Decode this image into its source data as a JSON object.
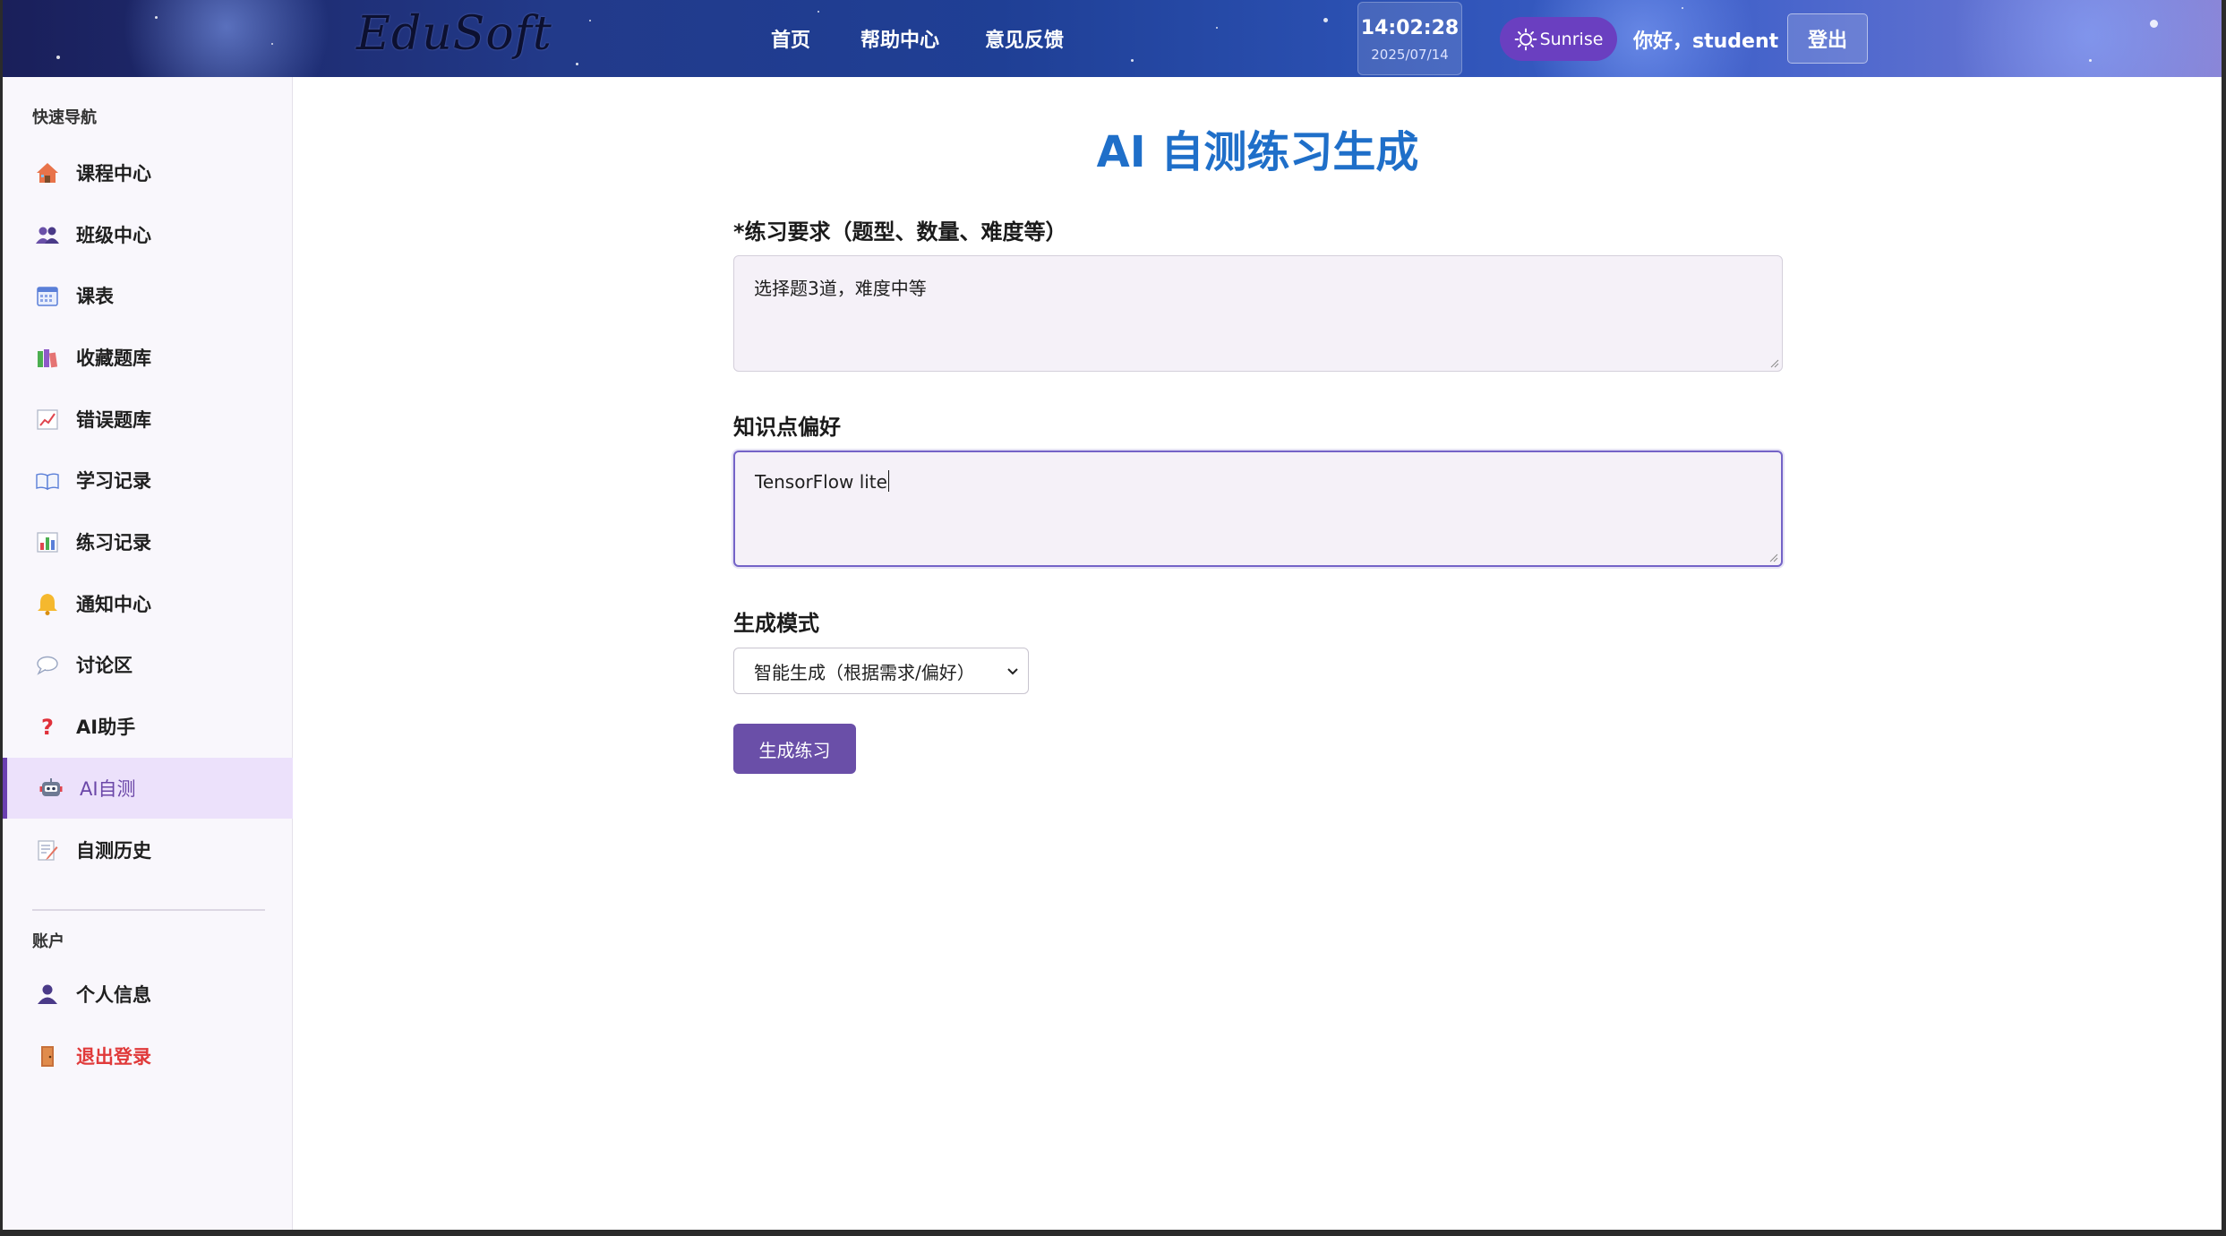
{
  "header": {
    "logo": "EduSoft",
    "nav": [
      "首页",
      "帮助中心",
      "意见反馈"
    ],
    "clock": {
      "time": "14:02:28",
      "date": "2025/07/14"
    },
    "theme_label": "Sunrise",
    "greeting": "你好，student",
    "logout_label": "登出"
  },
  "sidebar": {
    "nav_title": "快速导航",
    "items": [
      {
        "label": "课程中心",
        "icon": "house-icon"
      },
      {
        "label": "班级中心",
        "icon": "people-icon"
      },
      {
        "label": "课表",
        "icon": "calendar-icon"
      },
      {
        "label": "收藏题库",
        "icon": "books-icon"
      },
      {
        "label": "错误题库",
        "icon": "chart-up-icon"
      },
      {
        "label": "学习记录",
        "icon": "open-book-icon"
      },
      {
        "label": "练习记录",
        "icon": "bar-chart-icon"
      },
      {
        "label": "通知中心",
        "icon": "bell-icon"
      },
      {
        "label": "讨论区",
        "icon": "speech-bubble-icon"
      },
      {
        "label": "AI助手",
        "icon": "question-mark-icon"
      },
      {
        "label": "AI自测",
        "icon": "robot-icon",
        "active": true
      },
      {
        "label": "自测历史",
        "icon": "memo-icon"
      }
    ],
    "account_title": "账户",
    "account_items": [
      {
        "label": "个人信息",
        "icon": "user-icon"
      },
      {
        "label": "退出登录",
        "icon": "door-icon"
      }
    ]
  },
  "main": {
    "title": "AI 自测练习生成",
    "requirements_label": "*练习要求（题型、数量、难度等）",
    "requirements_value": "选择题3道，难度中等",
    "knowledge_label": "知识点偏好",
    "knowledge_value": "TensorFlow lite",
    "mode_label": "生成模式",
    "mode_selected": "智能生成（根据需求/偏好）",
    "generate_label": "生成练习"
  },
  "colors": {
    "accent": "#6a4fa8",
    "title": "#1f6fc9",
    "danger": "#e03a3a",
    "active_bg": "#ece1fb"
  }
}
